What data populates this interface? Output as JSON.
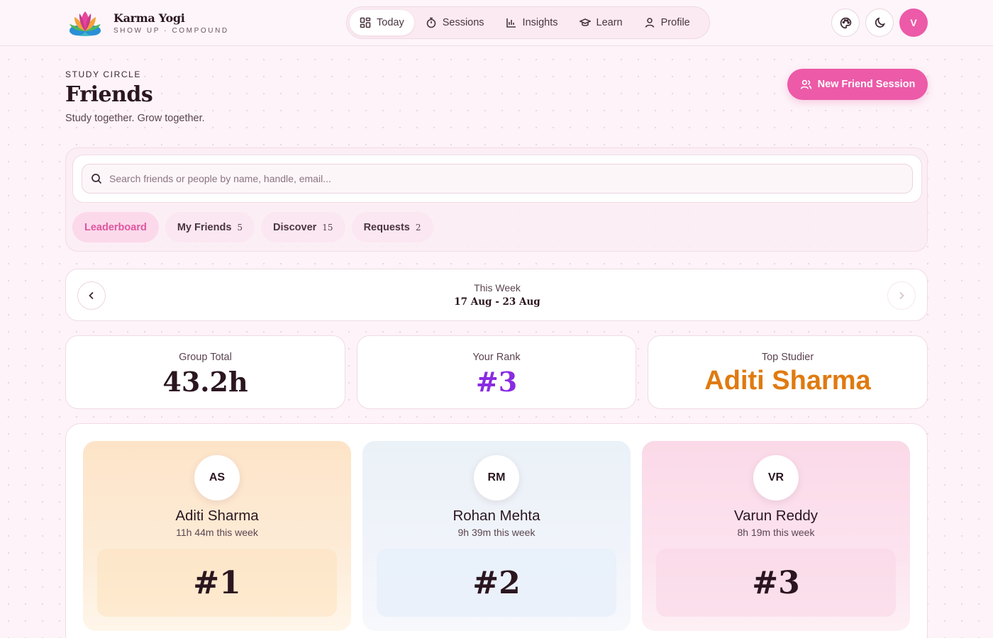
{
  "app": {
    "name": "Karma Yogi",
    "tagline": "SHOW UP · COMPOUND",
    "avatar_initial": "V"
  },
  "nav": [
    {
      "label": "Today",
      "icon": "dashboard-icon",
      "active": true
    },
    {
      "label": "Sessions",
      "icon": "timer-icon",
      "active": false
    },
    {
      "label": "Insights",
      "icon": "bar-chart-icon",
      "active": false
    },
    {
      "label": "Learn",
      "icon": "graduation-cap-icon",
      "active": false
    },
    {
      "label": "Profile",
      "icon": "user-icon",
      "active": false
    }
  ],
  "page": {
    "eyebrow": "STUDY CIRCLE",
    "title": "Friends",
    "subtitle": "Study together. Grow together.",
    "new_session_label": "New Friend Session"
  },
  "search": {
    "placeholder": "Search friends or people by name, handle, email..."
  },
  "tabs": [
    {
      "label": "Leaderboard",
      "count": "",
      "active": true
    },
    {
      "label": "My Friends",
      "count": "5",
      "active": false
    },
    {
      "label": "Discover",
      "count": "15",
      "active": false
    },
    {
      "label": "Requests",
      "count": "2",
      "active": false
    }
  ],
  "week": {
    "label": "This Week",
    "range": "17 Aug - 23 Aug"
  },
  "stats": [
    {
      "label": "Group Total",
      "value": "43.2h"
    },
    {
      "label": "Your Rank",
      "value": "#3"
    },
    {
      "label": "Top Studier",
      "value": "Aditi Sharma"
    }
  ],
  "podium": [
    {
      "initials": "AS",
      "name": "Aditi Sharma",
      "time": "11h 44m this week",
      "rank": "#1"
    },
    {
      "initials": "RM",
      "name": "Rohan Mehta",
      "time": "9h 39m this week",
      "rank": "#2"
    },
    {
      "initials": "VR",
      "name": "Varun Reddy",
      "time": "8h 19m this week",
      "rank": "#3"
    }
  ],
  "colors": {
    "accent": "#ec5aa8",
    "rank": "#8a2be2",
    "top": "#e07a10"
  }
}
